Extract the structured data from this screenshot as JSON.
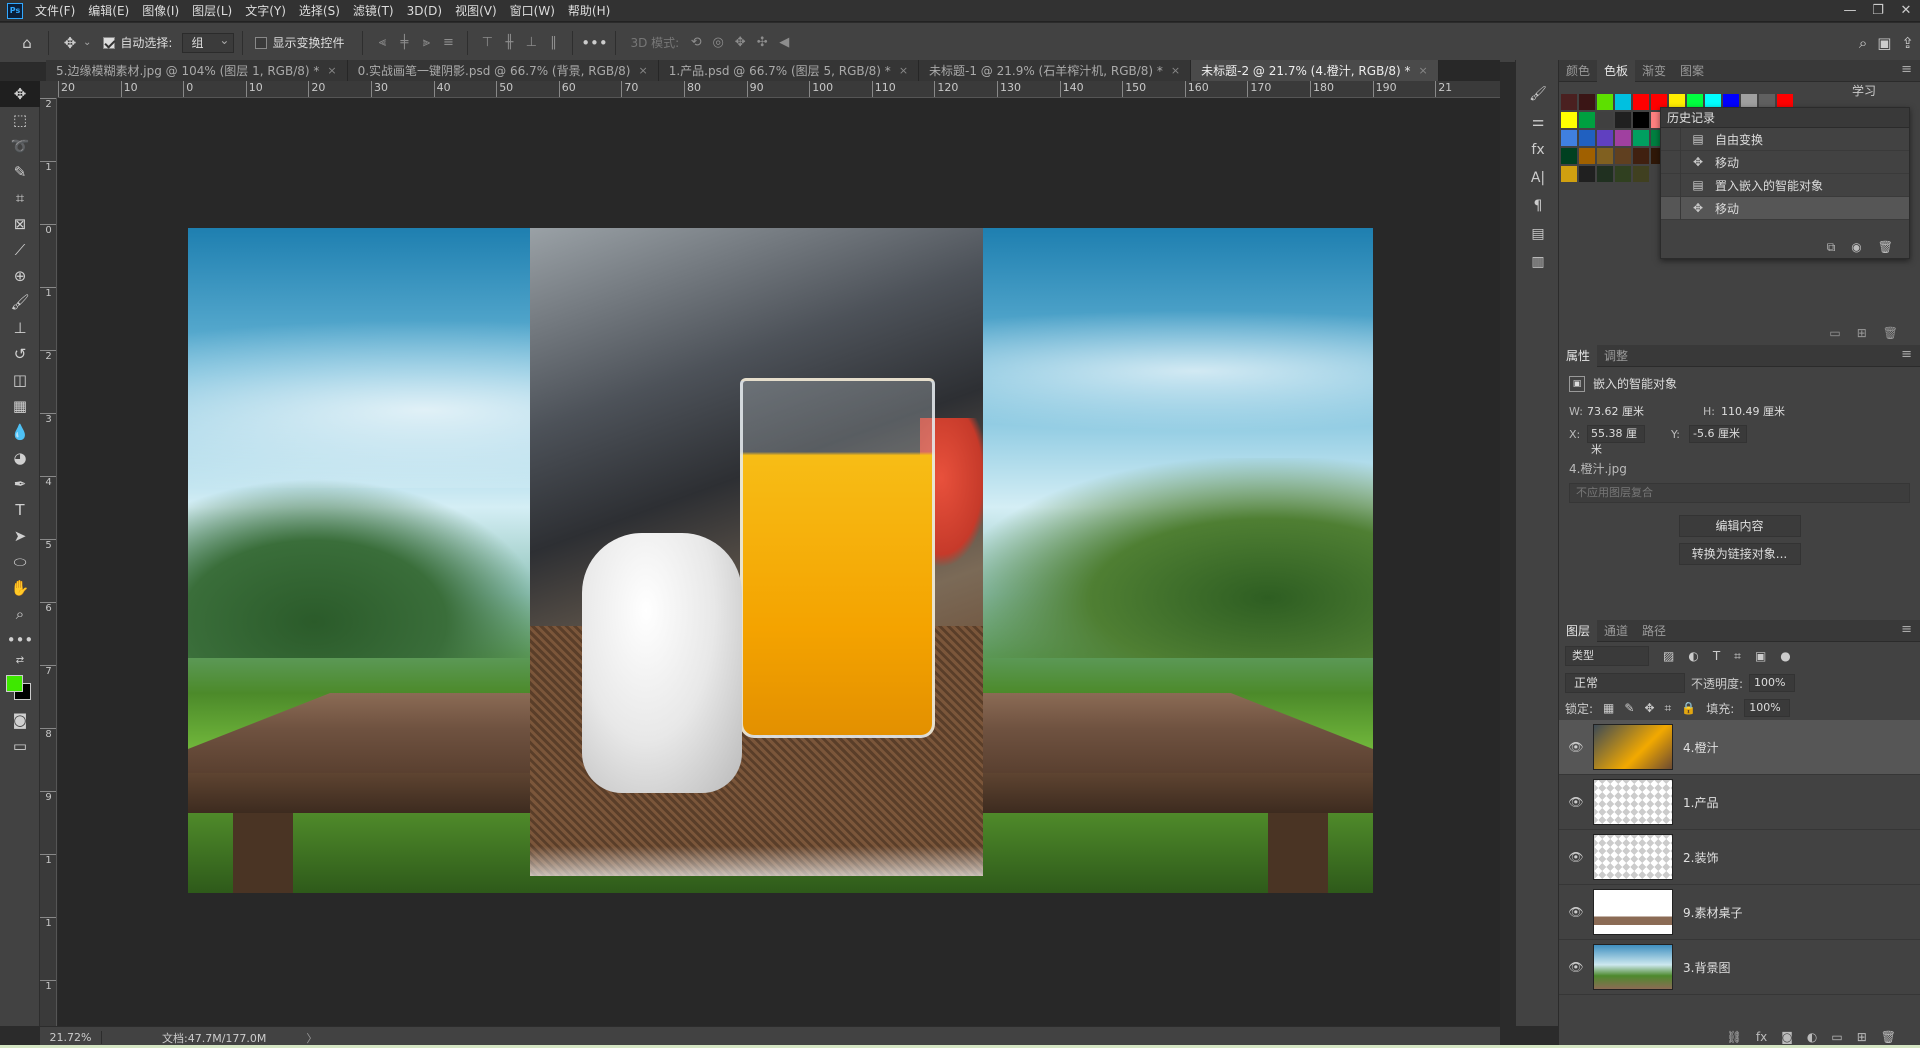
{
  "menubar": {
    "logo": "Ps",
    "items": [
      "文件(F)",
      "编辑(E)",
      "图像(I)",
      "图层(L)",
      "文字(Y)",
      "选择(S)",
      "滤镜(T)",
      "3D(D)",
      "视图(V)",
      "窗口(W)",
      "帮助(H)"
    ],
    "window_controls": [
      "—",
      "❐",
      "✕"
    ]
  },
  "options": {
    "auto_select_label": "自动选择:",
    "auto_select_value": "组",
    "show_transform_label": "显示变换控件",
    "mode_3d_label": "3D 模式:"
  },
  "tabs": [
    {
      "label": "5.边缘模糊素材.jpg @ 104% (图层 1, RGB/8) *",
      "close": "×"
    },
    {
      "label": "0.实战画笔一键阴影.psd @ 66.7% (背景, RGB/8)",
      "close": "×"
    },
    {
      "label": "1.产品.psd @ 66.7% (图层 5, RGB/8) *",
      "close": "×"
    },
    {
      "label": "未标题-1 @ 21.9% (石羊榨汁机, RGB/8) *",
      "close": "×"
    },
    {
      "label": "未标题-2 @ 21.7% (4.橙汁, RGB/8) *",
      "close": "×"
    }
  ],
  "ruler_h": [
    "20",
    "10",
    "0",
    "10",
    "20",
    "30",
    "40",
    "50",
    "60",
    "70",
    "80",
    "90",
    "100",
    "110",
    "120",
    "130",
    "140",
    "150",
    "160",
    "170",
    "180",
    "190",
    "21"
  ],
  "ruler_v": [
    "2",
    "1",
    "0",
    "1",
    "2",
    "3",
    "4",
    "5",
    "6",
    "7",
    "8",
    "9",
    "1",
    "1",
    "1"
  ],
  "status": {
    "zoom": "21.72%",
    "doc_info": "文档:47.7M/177.0M",
    "arrow": "〉"
  },
  "color_panel": {
    "tabs": [
      "颜色",
      "色板",
      "渐变",
      "图案"
    ],
    "active_tab": "色板",
    "swatches": [
      "#4a2020",
      "#3a1515",
      "#5de000",
      "#00c0e0",
      "#ff0000",
      "#ff0000",
      "#ffee00",
      "#00ff40",
      "#00ffff",
      "#0000ff",
      "#a0a0a0",
      "#606060",
      "#ff0000",
      "#ffff00",
      "#00a040",
      "#404040",
      "#202020",
      "#000000",
      "#ff8080",
      "#ffc080",
      "#8080e0",
      "#6060c0",
      "#a080e0",
      "#e080e0",
      "#c060c0",
      "#00a0e0",
      "#4080e0",
      "#2060c0",
      "#6040c0",
      "#a040a0",
      "#00a060",
      "#008040",
      "#006040",
      "#004080",
      "#203080",
      "#60a000",
      "#408000",
      "#206000",
      "#006020",
      "#004020",
      "#a06000",
      "#806020",
      "#604020",
      "#402010",
      "#301808",
      "#e0b070",
      "#c09050",
      "#a07030",
      "#804010",
      "#602000",
      "#00e0c0",
      "#e0d040",
      "#d0a010",
      "#202020",
      "#203020",
      "#304020",
      "#404020"
    ]
  },
  "history": {
    "title": "历史记录",
    "items": [
      {
        "icon": "▤",
        "label": "自由变换"
      },
      {
        "icon": "✥",
        "label": "移动"
      },
      {
        "icon": "▤",
        "label": "置入嵌入的智能对象"
      },
      {
        "icon": "✥",
        "label": "移动"
      }
    ]
  },
  "properties": {
    "tabs": [
      "属性",
      "调整"
    ],
    "object_type": "嵌入的智能对象",
    "w_label": "W:",
    "w": "73.62 厘米",
    "h_label": "H:",
    "h": "110.49 厘米",
    "x_label": "X:",
    "x": "55.38 厘米",
    "y_label": "Y:",
    "y": "-5.6 厘米",
    "file": "4.橙汁.jpg",
    "comp": "不应用图层复合",
    "edit_btn": "编辑内容",
    "convert_btn": "转换为链接对象..."
  },
  "layers_panel": {
    "tabs": [
      "图层",
      "通道",
      "路径"
    ],
    "kind": "类型",
    "blend": "正常",
    "opacity_label": "不透明度:",
    "opacity": "100%",
    "lock_label": "锁定:",
    "fill_label": "填充:",
    "fill": "100%",
    "layers": [
      {
        "name": "4.橙汁",
        "selected": true
      },
      {
        "name": "1.产品",
        "selected": false
      },
      {
        "name": "2.装饰",
        "selected": false
      },
      {
        "name": "9.素材桌子",
        "selected": false
      },
      {
        "name": "3.背景图",
        "selected": false
      }
    ]
  },
  "right_header": "学习",
  "colors": {
    "foreground": "#3ee800",
    "background": "#000000"
  }
}
